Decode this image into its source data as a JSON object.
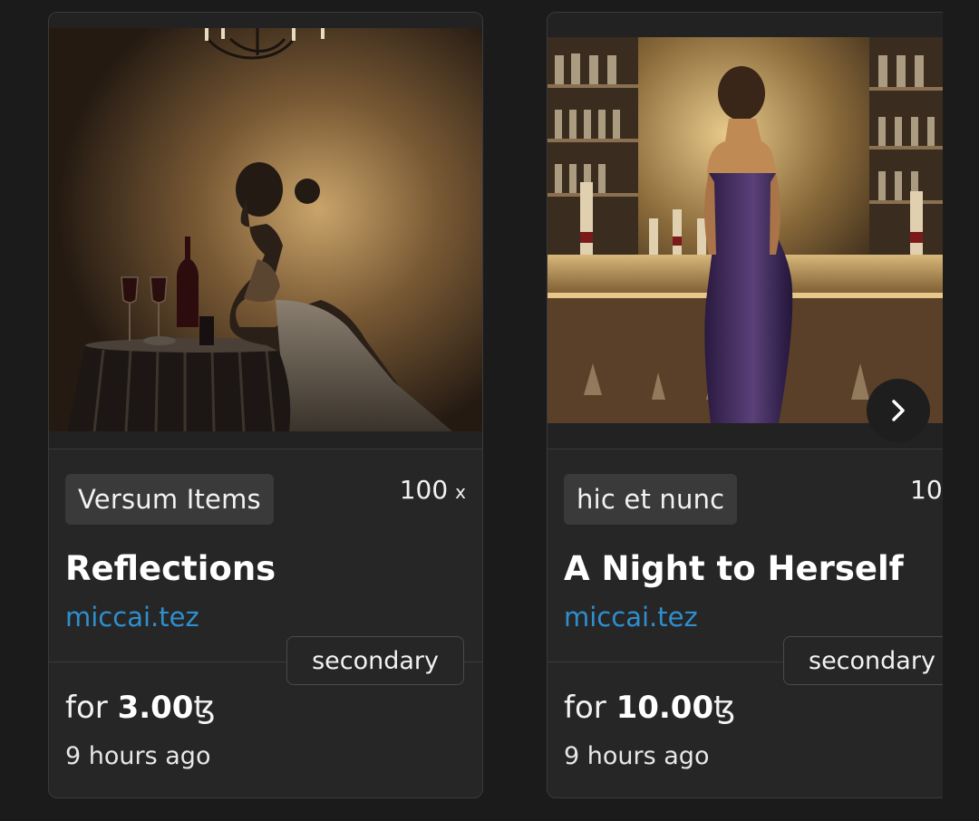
{
  "cards": [
    {
      "platform": "Versum Items",
      "edition": "100",
      "edition_suffix": "x",
      "title": "Reflections",
      "artist": "miccai.tez",
      "sale_type": "secondary",
      "price_prefix": "for",
      "price": "3.00",
      "currency": "ꜩ",
      "time": "9 hours ago",
      "artwork": "woman-seated-at-table-with-wine-painting"
    },
    {
      "platform": "hic et nunc",
      "edition": "10",
      "title": "A Night to Herself",
      "artist": "miccai.tez",
      "sale_type": "secondary",
      "price_prefix": "for",
      "price": "10.00",
      "currency": "ꜩ",
      "time": "9 hours ago",
      "artwork": "woman-in-purple-dress-at-bar-painting"
    }
  ],
  "carousel": {
    "next_icon": "chevron-right-icon"
  },
  "colors": {
    "background": "#1b1b1b",
    "card": "#262626",
    "artist_link": "#2e8fce",
    "tag_bg": "#3a3a3a"
  }
}
